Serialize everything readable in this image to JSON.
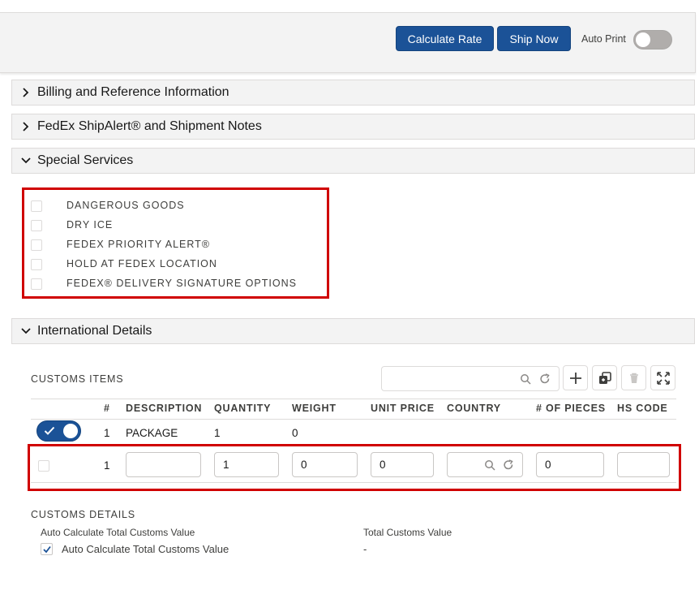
{
  "toolbar": {
    "calculate_label": "Calculate Rate",
    "ship_label": "Ship Now",
    "autoprint_label": "Auto Print",
    "autoprint_on": false
  },
  "sections": {
    "billing": "Billing and Reference Information",
    "shipalert": "FedEx ShipAlert® and Shipment Notes",
    "special": "Special Services",
    "international": "International Details"
  },
  "special_services": [
    {
      "label": "DANGEROUS GOODS",
      "checked": false
    },
    {
      "label": "DRY ICE",
      "checked": false
    },
    {
      "label": "FEDEX PRIORITY ALERT®",
      "checked": false
    },
    {
      "label": "HOLD AT FEDEX LOCATION",
      "checked": false
    },
    {
      "label": "FEDEX® DELIVERY SIGNATURE OPTIONS",
      "checked": false
    }
  ],
  "customs_items": {
    "title": "CUSTOMS ITEMS",
    "search_placeholder": "",
    "columns": [
      "#",
      "DESCRIPTION",
      "QUANTITY",
      "WEIGHT",
      "UNIT PRICE",
      "COUNTRY",
      "# OF PIECES",
      "HS CODE"
    ],
    "rows": [
      {
        "selected": true,
        "num": "1",
        "description": "PACKAGE",
        "quantity": "1",
        "weight": "0",
        "unit_price": "",
        "country": "",
        "pieces": "",
        "hs_code": ""
      }
    ],
    "edit_row": {
      "num": "1",
      "description": "",
      "quantity": "1",
      "weight": "0",
      "unit_price": "0",
      "country": "",
      "pieces": "0",
      "hs_code": ""
    }
  },
  "customs_details": {
    "title": "CUSTOMS DETAILS",
    "auto_calc_header": "Auto Calculate Total Customs Value",
    "auto_calc_checkbox_label": "Auto Calculate Total Customs Value",
    "auto_calc_checked": true,
    "total_header": "Total Customs Value",
    "total_value": "-"
  },
  "colors": {
    "brand": "#1b5297",
    "highlight": "#d00000"
  }
}
